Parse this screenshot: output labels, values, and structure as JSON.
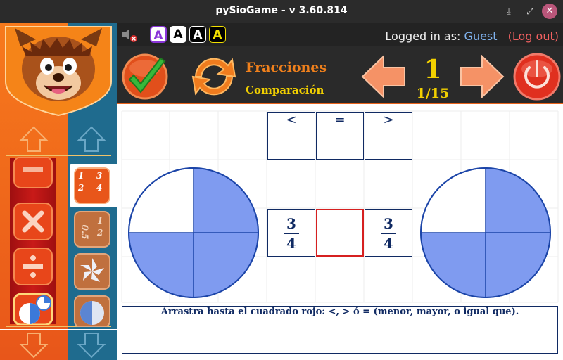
{
  "window": {
    "title": "pySioGame - v 3.60.814",
    "download_symbol": "⤓",
    "maximize_symbol": "⤢",
    "close_symbol": "✕"
  },
  "infobar": {
    "aaa_letters": [
      "A",
      "A",
      "A",
      "A"
    ],
    "logged_in_label": "Logged in as:",
    "user_name": "Guest",
    "logout_label": "(Log out)"
  },
  "game": {
    "title": "Fracciones",
    "subtitle": "Comparación",
    "level": "1",
    "counter": "1/15"
  },
  "comparison": {
    "symbols": [
      "<",
      "=",
      ">"
    ],
    "left": {
      "numerator": "3",
      "denominator": "4",
      "filled_quarters": 3
    },
    "right": {
      "numerator": "3",
      "denominator": "4",
      "filled_quarters": 3
    }
  },
  "instruction": "Arrastra hasta el cuadrado rojo: <, > ó = (menor, mayor, o igual que).",
  "sidebar_icons": {
    "fraction_icon": {
      "top_num": "1",
      "top_den": "2",
      "right_num": "3",
      "right_den": "4"
    },
    "decimal_icon": {
      "a": "0.5",
      "b_num": "1",
      "b_den": "2"
    }
  },
  "colors": {
    "title_bar": "#2b2b2b",
    "orange_accent": "#e8631c",
    "yellow_text": "#f2d000",
    "teal_panel": "#1f6b8e",
    "pie_fill": "#7f9bf0",
    "pie_stroke": "#1c45a8",
    "navy_text": "#102a63",
    "target_border": "#d62020",
    "guest_link": "#7fb2ee",
    "logout_link": "#f06060"
  }
}
